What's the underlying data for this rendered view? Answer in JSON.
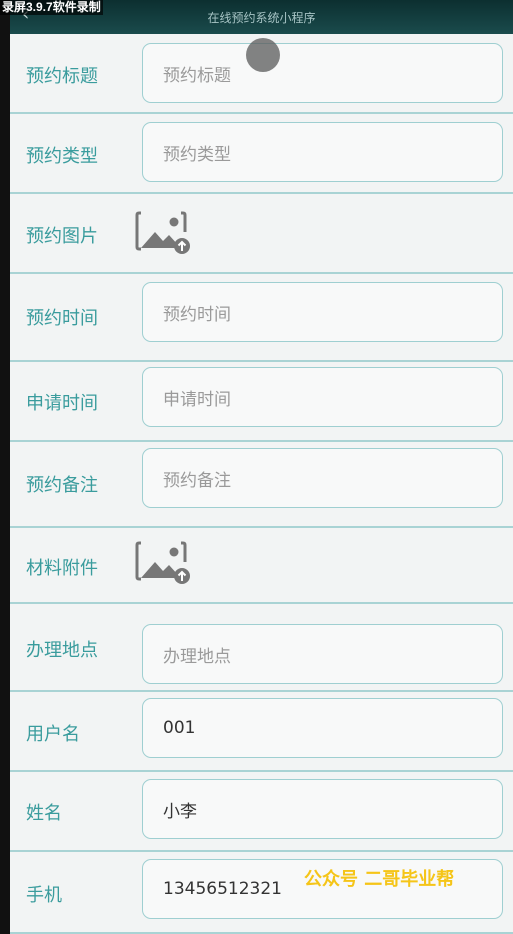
{
  "header": {
    "title": "在线预约系统小程序",
    "back_glyph": "‹"
  },
  "watermark": "录屏3.9.7软件录制",
  "promo": "公众号 二哥毕业帮",
  "fields": [
    {
      "label": "预约标题",
      "value": "预约标题",
      "filled": false
    },
    {
      "label": "预约类型",
      "value": "预约类型",
      "filled": false
    },
    {
      "label": "预约图片",
      "icon": "image-upload-icon"
    },
    {
      "label": "预约时间",
      "value": "预约时间",
      "filled": false
    },
    {
      "label": "申请时间",
      "value": "申请时间",
      "filled": false
    },
    {
      "label": "预约备注",
      "value": "预约备注",
      "filled": false
    },
    {
      "label": "材料附件",
      "icon": "image-upload-icon"
    },
    {
      "label": "办理地点",
      "value": "办理地点",
      "filled": false
    },
    {
      "label": "用户名",
      "value": "001",
      "filled": true
    },
    {
      "label": "姓名",
      "value": "小李",
      "filled": true
    },
    {
      "label": "手机",
      "value": "13456512321",
      "filled": true
    }
  ]
}
